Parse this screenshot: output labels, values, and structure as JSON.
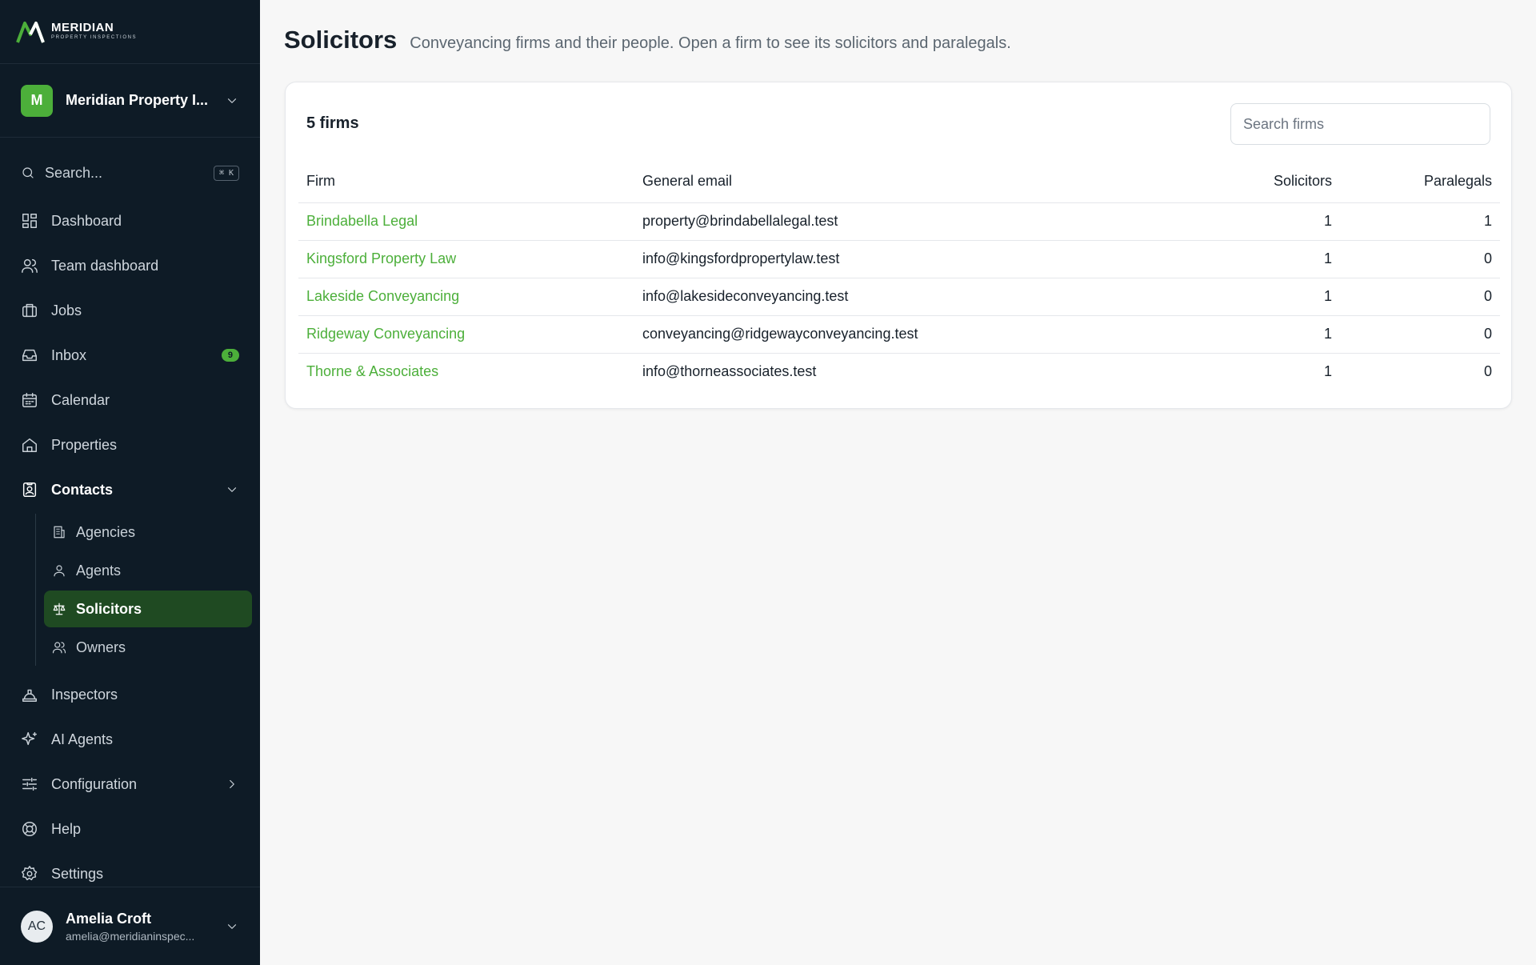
{
  "brand": {
    "name": "MERIDIAN",
    "tagline": "PROPERTY INSPECTIONS"
  },
  "org": {
    "initial": "M",
    "name": "Meridian Property I..."
  },
  "search": {
    "label": "Search...",
    "shortcut": "⌘ K"
  },
  "nav": {
    "dashboard": "Dashboard",
    "team_dashboard": "Team dashboard",
    "jobs": "Jobs",
    "inbox": "Inbox",
    "inbox_badge": "9",
    "calendar": "Calendar",
    "properties": "Properties",
    "contacts": "Contacts",
    "contacts_sub": {
      "agencies": "Agencies",
      "agents": "Agents",
      "solicitors": "Solicitors",
      "owners": "Owners"
    },
    "inspectors": "Inspectors",
    "ai_agents": "AI Agents",
    "configuration": "Configuration",
    "help": "Help",
    "settings": "Settings"
  },
  "user": {
    "initials": "AC",
    "name": "Amelia Croft",
    "email": "amelia@meridianinspec..."
  },
  "page": {
    "title": "Solicitors",
    "subtitle": "Conveyancing firms and their people. Open a firm to see its solicitors and paralegals."
  },
  "card": {
    "count_label": "5 firms",
    "search_placeholder": "Search firms",
    "columns": {
      "firm": "Firm",
      "email": "General email",
      "solicitors": "Solicitors",
      "paralegals": "Paralegals"
    },
    "rows": [
      {
        "firm": "Brindabella Legal",
        "email": "property@brindabellalegal.test",
        "solicitors": "1",
        "paralegals": "1"
      },
      {
        "firm": "Kingsford Property Law",
        "email": "info@kingsfordpropertylaw.test",
        "solicitors": "1",
        "paralegals": "0"
      },
      {
        "firm": "Lakeside Conveyancing",
        "email": "info@lakesideconveyancing.test",
        "solicitors": "1",
        "paralegals": "0"
      },
      {
        "firm": "Ridgeway Conveyancing",
        "email": "conveyancing@ridgewayconveyancing.test",
        "solicitors": "1",
        "paralegals": "0"
      },
      {
        "firm": "Thorne & Associates",
        "email": "info@thorneassociates.test",
        "solicitors": "1",
        "paralegals": "0"
      }
    ]
  },
  "colors": {
    "accent": "#4caf3a",
    "sidebar_bg": "#0e1b26",
    "active_bg": "#1f4a22"
  }
}
